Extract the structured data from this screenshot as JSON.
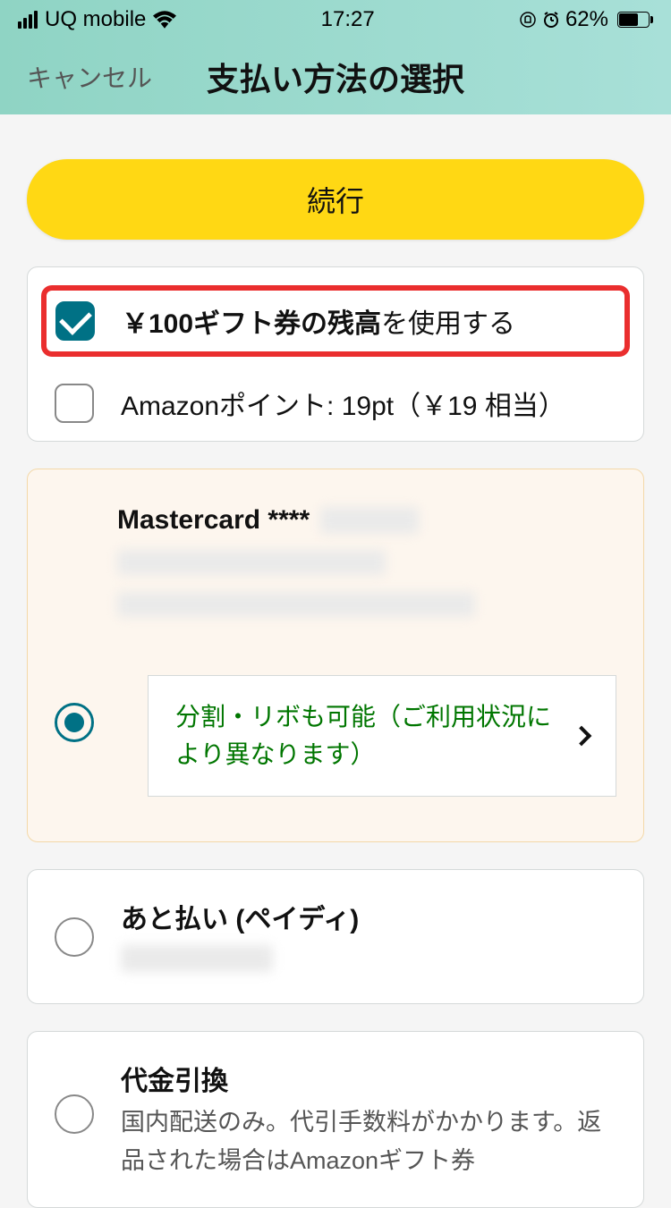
{
  "status": {
    "carrier": "UQ mobile",
    "time": "17:27",
    "battery_pct": "62%"
  },
  "nav": {
    "cancel": "キャンセル",
    "title": "支払い方法の選択"
  },
  "continue_label": "続行",
  "gift": {
    "bold": "￥100ギフト券の残高",
    "rest": "を使用する"
  },
  "points": {
    "label": "Amazonポイント: 19pt（￥19 相当）"
  },
  "mastercard": {
    "title": "Mastercard ****",
    "installment": "分割・リボも可能（ご利用状況により異なります）"
  },
  "paidy": {
    "title": "あと払い (ペイディ)"
  },
  "cod": {
    "title": "代金引換",
    "desc": "国内配送のみ。代引手数料がかかります。返品された場合はAmazonギフト券"
  }
}
